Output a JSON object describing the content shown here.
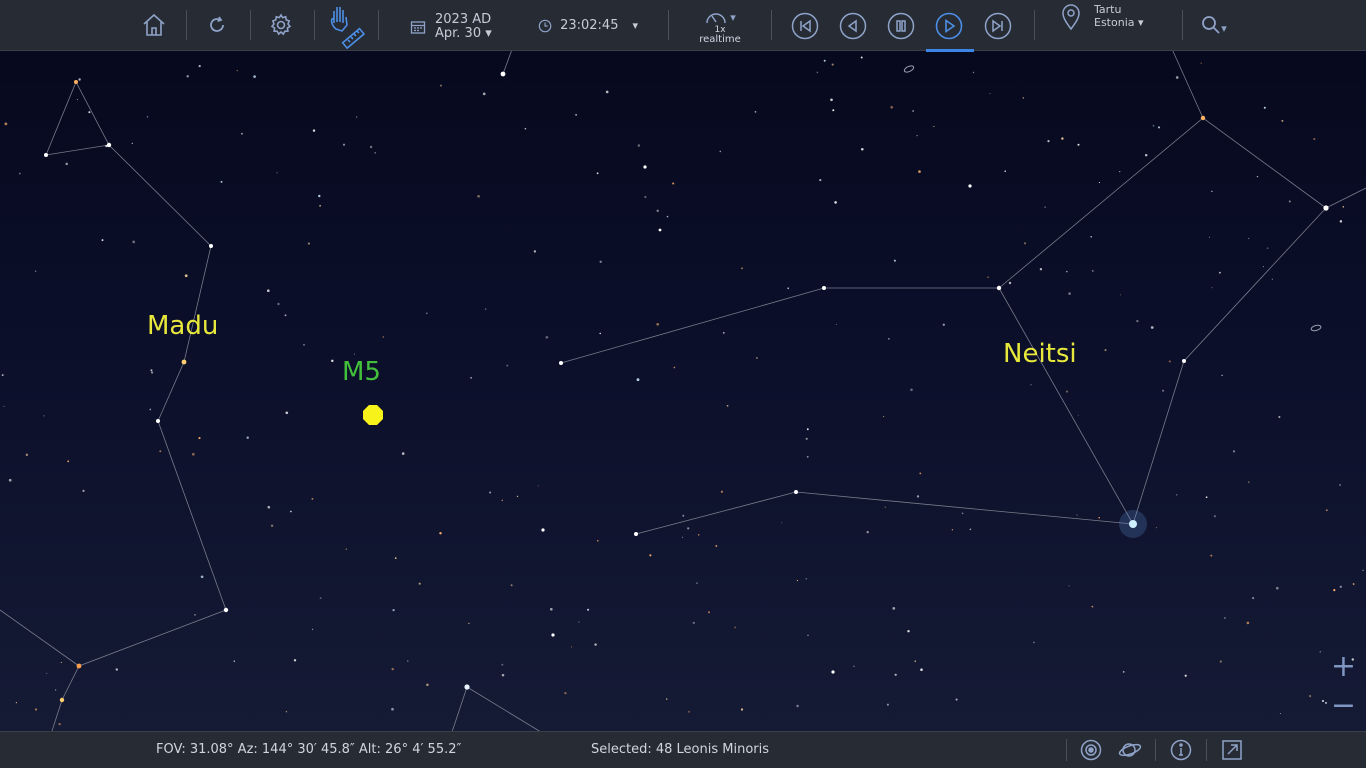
{
  "toolbar": {
    "date_year": "2023 AD",
    "date_day": "Apr. 30 ▾",
    "time": "23:02:45",
    "time_dropdown": "▾",
    "speed_dropdown": "▾",
    "speed_value": "1x",
    "speed_mode": "realtime",
    "location_city": "Tartu",
    "location_country": "Estonia ▾",
    "search_dropdown": "▾",
    "icons": [
      "home-icon",
      "refresh-icon",
      "gear-icon",
      "hand-ruler-icon",
      "calendar-icon",
      "clock-icon",
      "speedometer-icon",
      "skip-back-icon",
      "step-back-icon",
      "pause-icon",
      "play-icon",
      "skip-forward-icon",
      "location-pin-icon",
      "search-icon"
    ]
  },
  "sky": {
    "labels": [
      {
        "name": "madu",
        "text": "Madu",
        "color": "#e8e83c"
      },
      {
        "name": "m5",
        "text": "M5",
        "color": "#43c13a"
      },
      {
        "name": "neitsi",
        "text": "Neitsi",
        "color": "#e8e83c"
      }
    ],
    "marker_color": "#f7f21a"
  },
  "statusbar": {
    "fov_text": "FOV: 31.08° Az: 144° 30′ 45.8″ Alt: 26° 4′ 55.2″",
    "selected_text": "Selected: 48 Leonis Minoris",
    "icons": [
      "target-icon",
      "orbit-icon",
      "info-icon",
      "external-link-icon"
    ]
  },
  "zoom": {
    "in_label": "+",
    "out_label": "−"
  }
}
